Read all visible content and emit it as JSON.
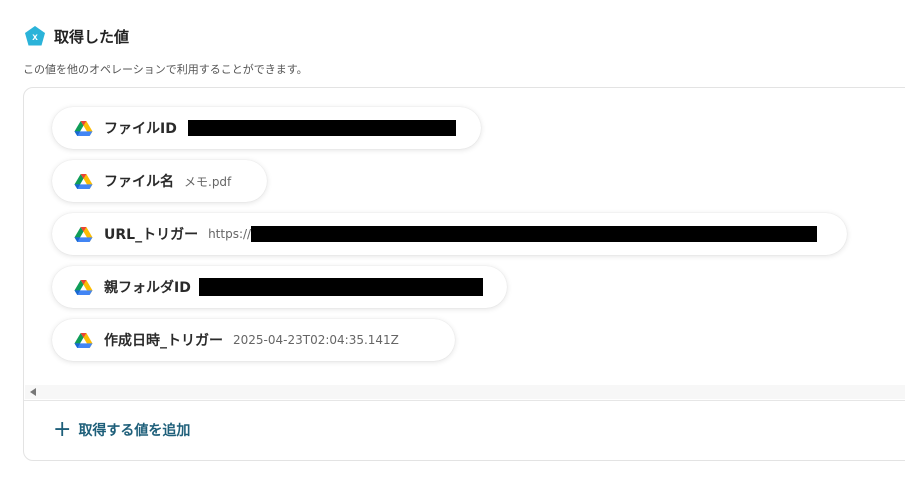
{
  "header": {
    "title": "取得した値",
    "subtitle": "この値を他のオペレーションで利用することができます。",
    "icon": "variable-x-icon",
    "icon_color": "#2bb3d9"
  },
  "values": [
    {
      "label": "ファイルID",
      "value": "",
      "redacted": true
    },
    {
      "label": "ファイル名",
      "value": "メモ.pdf",
      "redacted": false
    },
    {
      "label": "URL_トリガー",
      "value": "https://",
      "redacted": true
    },
    {
      "label": "親フォルダID",
      "value": "",
      "redacted": true
    },
    {
      "label": "作成日時_トリガー",
      "value": "2025-04-23T02:04:35.141Z",
      "redacted": false
    }
  ],
  "add_button": {
    "label": "取得する値を追加",
    "icon": "plus-icon"
  },
  "colors": {
    "accent": "#1e5f7a",
    "background": "#ffffff"
  }
}
